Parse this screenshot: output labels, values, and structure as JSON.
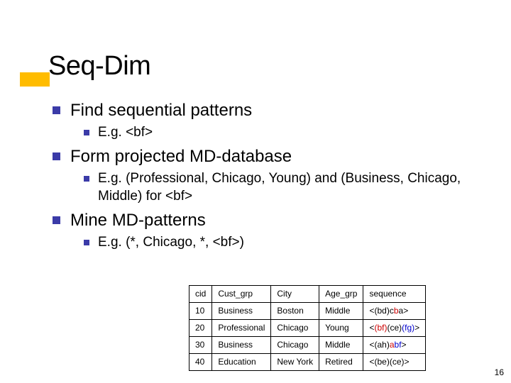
{
  "title": "Seq-Dim",
  "bullets": {
    "b1": "Find sequential patterns",
    "b1_1": "E.g. <bf>",
    "b2": "Form projected MD-database",
    "b2_1": "E.g. (Professional, Chicago, Young) and (Business, Chicago, Middle) for <bf>",
    "b3": "Mine MD-patterns",
    "b3_1": "E.g. (*, Chicago, *, <bf>)"
  },
  "table": {
    "headers": {
      "c0": "cid",
      "c1": "Cust_grp",
      "c2": "City",
      "c3": "Age_grp",
      "c4": "sequence"
    },
    "rows": [
      {
        "cid": "10",
        "grp": "Business",
        "city": "Boston",
        "age": "Middle",
        "seq_pre": "<(bd)c",
        "seq_a": "b",
        "seq_mid": "a",
        "seq_b": "",
        "seq_post": ">"
      },
      {
        "cid": "20",
        "grp": "Professional",
        "city": "Chicago",
        "age": "Young",
        "seq_pre": "<",
        "seq_a": "(bf)",
        "seq_mid": "(ce)",
        "seq_b": "(fg)",
        "seq_post": ">"
      },
      {
        "cid": "30",
        "grp": "Business",
        "city": "Chicago",
        "age": "Middle",
        "seq_pre": "<(ah)",
        "seq_a": "a",
        "seq_mid": "",
        "seq_b": "bf",
        "seq_post": ">"
      },
      {
        "cid": "40",
        "grp": "Education",
        "city": "New York",
        "age": "Retired",
        "seq_pre": "<(be)(ce)>",
        "seq_a": "",
        "seq_mid": "",
        "seq_b": "",
        "seq_post": ""
      }
    ]
  },
  "page_number": "16",
  "chart_data": {
    "type": "table",
    "columns": [
      "cid",
      "Cust_grp",
      "City",
      "Age_grp",
      "sequence"
    ],
    "rows": [
      [
        "10",
        "Business",
        "Boston",
        "Middle",
        "<(bd)cba>"
      ],
      [
        "20",
        "Professional",
        "Chicago",
        "Young",
        "<(bf)(ce)(fg)>"
      ],
      [
        "30",
        "Business",
        "Chicago",
        "Middle",
        "<(ah)abf>"
      ],
      [
        "40",
        "Education",
        "New York",
        "Retired",
        "<(be)(ce)>"
      ]
    ]
  }
}
